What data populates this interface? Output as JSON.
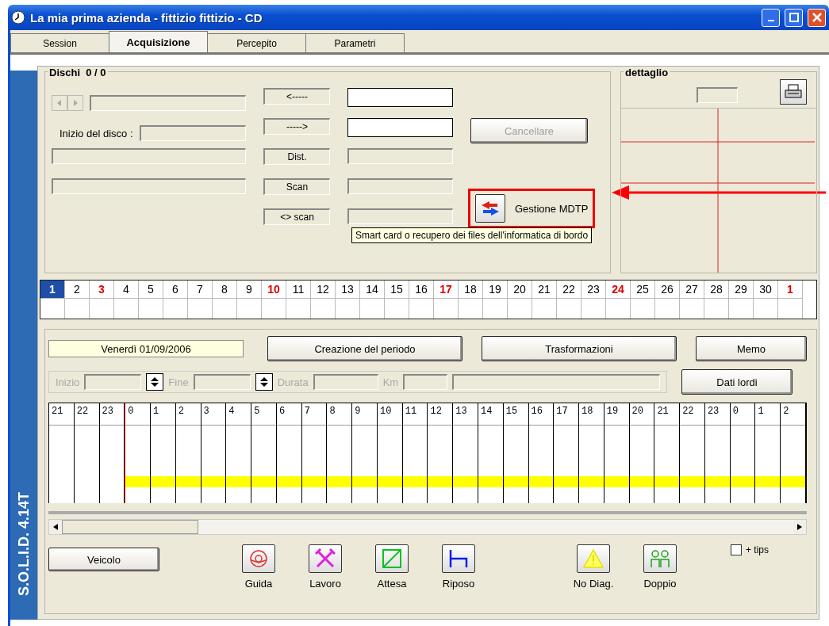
{
  "window": {
    "title": "La mia prima azienda - fittizio fittizio - CD"
  },
  "tabs": [
    {
      "label": "Session",
      "selected": false
    },
    {
      "label": "Acquisizione",
      "selected": true
    },
    {
      "label": "Percepito",
      "selected": false
    },
    {
      "label": "Parametri",
      "selected": false
    }
  ],
  "side_label": "S.O.L.I.D. 4.14T",
  "disks": {
    "title": "Dischi  0 / 0",
    "start_label": "Inizio del disco :",
    "nav_buttons": [
      "<-----",
      "----->",
      "Dist.",
      "Scan",
      "<> scan"
    ],
    "cancel": {
      "label": "Cancellare",
      "disabled": true
    },
    "mdtp": {
      "label": "Gestione MDTP",
      "highlighted": true
    },
    "tooltip": "Smart card o recupero dei files dell'informatica di bordo"
  },
  "detail": {
    "title": "dettaglio"
  },
  "days": [
    {
      "label": "1",
      "selected": true,
      "holiday": true
    },
    {
      "label": "2",
      "selected": false,
      "holiday": false
    },
    {
      "label": "3",
      "selected": false,
      "holiday": true
    },
    {
      "label": "4",
      "selected": false,
      "holiday": false
    },
    {
      "label": "5",
      "selected": false,
      "holiday": false
    },
    {
      "label": "6",
      "selected": false,
      "holiday": false
    },
    {
      "label": "7",
      "selected": false,
      "holiday": false
    },
    {
      "label": "8",
      "selected": false,
      "holiday": false
    },
    {
      "label": "9",
      "selected": false,
      "holiday": false
    },
    {
      "label": "10",
      "selected": false,
      "holiday": true
    },
    {
      "label": "11",
      "selected": false,
      "holiday": false
    },
    {
      "label": "12",
      "selected": false,
      "holiday": false
    },
    {
      "label": "13",
      "selected": false,
      "holiday": false
    },
    {
      "label": "14",
      "selected": false,
      "holiday": false
    },
    {
      "label": "15",
      "selected": false,
      "holiday": false
    },
    {
      "label": "16",
      "selected": false,
      "holiday": false
    },
    {
      "label": "17",
      "selected": false,
      "holiday": true
    },
    {
      "label": "18",
      "selected": false,
      "holiday": false
    },
    {
      "label": "19",
      "selected": false,
      "holiday": false
    },
    {
      "label": "20",
      "selected": false,
      "holiday": false
    },
    {
      "label": "21",
      "selected": false,
      "holiday": false
    },
    {
      "label": "22",
      "selected": false,
      "holiday": false
    },
    {
      "label": "23",
      "selected": false,
      "holiday": false
    },
    {
      "label": "24",
      "selected": false,
      "holiday": true
    },
    {
      "label": "25",
      "selected": false,
      "holiday": false
    },
    {
      "label": "26",
      "selected": false,
      "holiday": false
    },
    {
      "label": "27",
      "selected": false,
      "holiday": false
    },
    {
      "label": "28",
      "selected": false,
      "holiday": false
    },
    {
      "label": "29",
      "selected": false,
      "holiday": false
    },
    {
      "label": "30",
      "selected": false,
      "holiday": false
    },
    {
      "label": "1",
      "selected": false,
      "holiday": true
    }
  ],
  "period": {
    "date": "Venerdì 01/09/2006",
    "buttons": [
      "Creazione del periodo",
      "Trasformazioni",
      "Memo"
    ],
    "fields": [
      {
        "label": "Inizio",
        "kind": "spin"
      },
      {
        "label": "Fine",
        "kind": "spin"
      },
      {
        "label": "Durata",
        "kind": "plain"
      },
      {
        "label": "Km",
        "kind": "wide"
      }
    ],
    "raw_button": "Dati lordi",
    "vehicle_button": "Veicolo"
  },
  "hours": [
    {
      "label": "21",
      "day_start": false,
      "active": false
    },
    {
      "label": "22",
      "day_start": false,
      "active": false
    },
    {
      "label": "23",
      "day_start": false,
      "active": false
    },
    {
      "label": "0",
      "day_start": true,
      "active": true
    },
    {
      "label": "1",
      "day_start": false,
      "active": true
    },
    {
      "label": "2",
      "day_start": false,
      "active": true
    },
    {
      "label": "3",
      "day_start": false,
      "active": true
    },
    {
      "label": "4",
      "day_start": false,
      "active": true
    },
    {
      "label": "5",
      "day_start": false,
      "active": true
    },
    {
      "label": "6",
      "day_start": false,
      "active": true
    },
    {
      "label": "7",
      "day_start": false,
      "active": true
    },
    {
      "label": "8",
      "day_start": false,
      "active": true
    },
    {
      "label": "9",
      "day_start": false,
      "active": true
    },
    {
      "label": "10",
      "day_start": false,
      "active": true
    },
    {
      "label": "11",
      "day_start": false,
      "active": true
    },
    {
      "label": "12",
      "day_start": false,
      "active": true
    },
    {
      "label": "13",
      "day_start": false,
      "active": true
    },
    {
      "label": "14",
      "day_start": false,
      "active": true
    },
    {
      "label": "15",
      "day_start": false,
      "active": true
    },
    {
      "label": "16",
      "day_start": false,
      "active": true
    },
    {
      "label": "17",
      "day_start": false,
      "active": true
    },
    {
      "label": "18",
      "day_start": false,
      "active": true
    },
    {
      "label": "19",
      "day_start": false,
      "active": true
    },
    {
      "label": "20",
      "day_start": false,
      "active": true
    },
    {
      "label": "21",
      "day_start": false,
      "active": true
    },
    {
      "label": "22",
      "day_start": false,
      "active": true
    },
    {
      "label": "23",
      "day_start": false,
      "active": true
    },
    {
      "label": "0",
      "day_start": false,
      "active": true
    },
    {
      "label": "1",
      "day_start": false,
      "active": true
    },
    {
      "label": "2",
      "day_start": false,
      "active": true
    }
  ],
  "activities": [
    {
      "label": "Guida",
      "kind": "drive"
    },
    {
      "label": "Lavoro",
      "kind": "work"
    },
    {
      "label": "Attesa",
      "kind": "wait"
    },
    {
      "label": "Riposo",
      "kind": "rest"
    },
    {
      "label": "No Diag.",
      "kind": "nodiag"
    },
    {
      "label": "Doppio",
      "kind": "double"
    }
  ],
  "tips": {
    "label": "+ tips",
    "checked": false
  }
}
